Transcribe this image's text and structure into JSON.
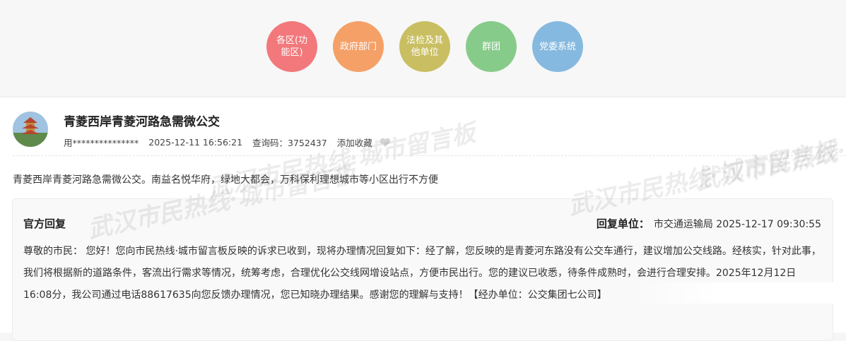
{
  "categories": [
    {
      "label": "各区(功能区)",
      "color": "#f2787b"
    },
    {
      "label": "政府部门",
      "color": "#f5a067"
    },
    {
      "label": "法检及其他单位",
      "color": "#c9bf62"
    },
    {
      "label": "群团",
      "color": "#87cb8b"
    },
    {
      "label": "党委系统",
      "color": "#86b9df"
    }
  ],
  "post": {
    "title": "青菱西岸青菱河路急需微公交",
    "user": "用***************",
    "datetime": "2025-12-11 16:56:21",
    "query_code": "查询码：3752437",
    "favorite": "添加收藏",
    "content": "青菱西岸青菱河路急需微公交。南益名悦华府，绿地大都会，万科保利理想城市等小区出行不方便"
  },
  "reply": {
    "label": "官方回复",
    "unit_label": "回复单位：",
    "unit": "市交通运输局 2025-12-17 09:30:55",
    "text": "尊敬的市民： 您好！您向市民热线·城市留言板反映的诉求已收到，现将办理情况回复如下：经了解，您反映的是青菱河东路没有公交车通行，建议增加公交线路。经核实，针对此事，我们将根据新的道路条件，客流出行需求等情况，统筹考虑，合理优化公交线网增设站点，方便市民出行。您的建议已收悉，待条件成熟时，会进行合理安排。2025年12月12日16:08分，我公司通过电话88617635向您反馈办理情况，您已知晓办理结果。感谢您的理解与支持！【经办单位：公交集团七公司】"
  },
  "watermark": "武汉市民热线·城市留言板"
}
